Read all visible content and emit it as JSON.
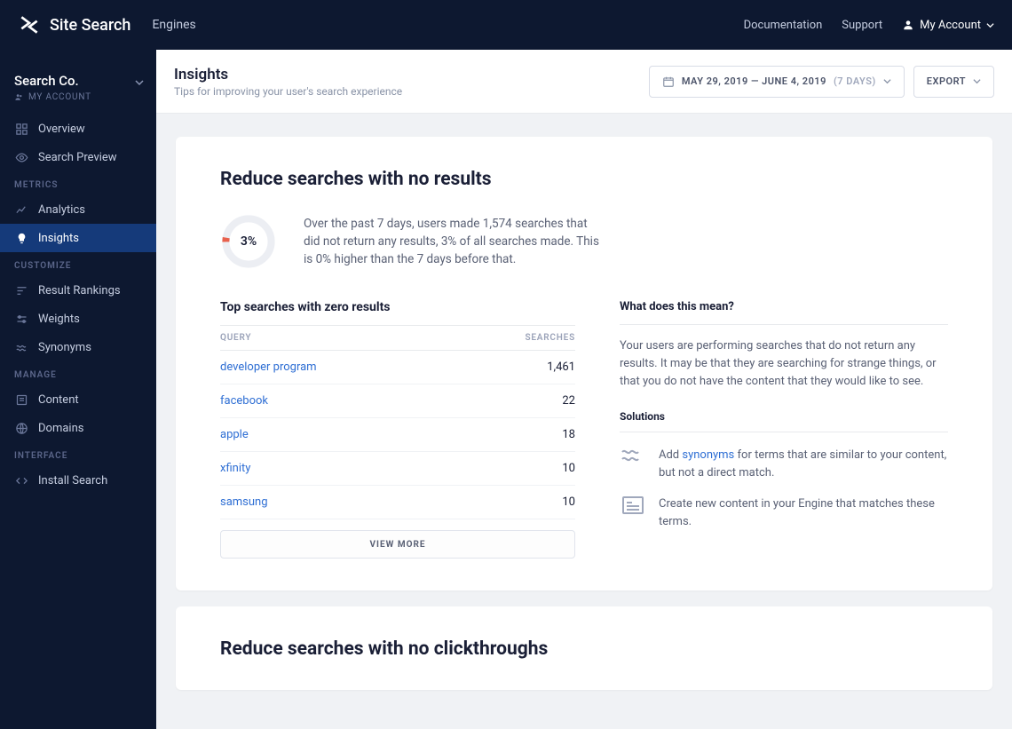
{
  "topbar": {
    "brand": "Site Search",
    "engines": "Engines",
    "documentation": "Documentation",
    "support": "Support",
    "my_account": "My Account"
  },
  "engine": {
    "name": "Search Co.",
    "sub": "MY ACCOUNT"
  },
  "sidebar": {
    "sections": [
      {
        "heading": null,
        "items": [
          {
            "icon": "grid",
            "label": "Overview"
          },
          {
            "icon": "eye",
            "label": "Search Preview"
          }
        ]
      },
      {
        "heading": "METRICS",
        "items": [
          {
            "icon": "chart",
            "label": "Analytics"
          },
          {
            "icon": "bulb",
            "label": "Insights",
            "active": true
          }
        ]
      },
      {
        "heading": "CUSTOMIZE",
        "items": [
          {
            "icon": "rank",
            "label": "Result Rankings"
          },
          {
            "icon": "sliders",
            "label": "Weights"
          },
          {
            "icon": "wave",
            "label": "Synonyms"
          }
        ]
      },
      {
        "heading": "MANAGE",
        "items": [
          {
            "icon": "doc",
            "label": "Content"
          },
          {
            "icon": "globe",
            "label": "Domains"
          }
        ]
      },
      {
        "heading": "INTERFACE",
        "items": [
          {
            "icon": "code",
            "label": "Install Search"
          }
        ]
      }
    ]
  },
  "page": {
    "title": "Insights",
    "subtitle": "Tips for improving your user's search experience",
    "date_range": "MAY 29, 2019 — JUNE 4, 2019",
    "date_days": "(7 DAYS)",
    "export": "EXPORT"
  },
  "card1": {
    "title": "Reduce searches with no results",
    "donut_pct": "3%",
    "donut_value": 3,
    "summary": "Over the past 7 days, users made 1,574 searches that did not return any results, 3% of all searches made. This is 0% higher than the 7 days before that.",
    "top_title": "Top searches with zero results",
    "col_query": "QUERY",
    "col_searches": "SEARCHES",
    "rows": [
      {
        "query": "developer program",
        "searches": "1,461"
      },
      {
        "query": "facebook",
        "searches": "22"
      },
      {
        "query": "apple",
        "searches": "18"
      },
      {
        "query": "xfinity",
        "searches": "10"
      },
      {
        "query": "samsung",
        "searches": "10"
      }
    ],
    "view_more": "VIEW MORE",
    "help_title": "What does this mean?",
    "help_text": "Your users are performing searches that do not return any results. It may be that they are searching for strange things, or that you do not have the content that they would like to see.",
    "sol_title": "Solutions",
    "sol1_prefix": "Add ",
    "sol1_link": "synonyms",
    "sol1_suffix": " for terms that are similar to your content, but not a direct match.",
    "sol2": "Create new content in your Engine that matches these terms."
  },
  "card2": {
    "title": "Reduce searches with no clickthroughs"
  }
}
